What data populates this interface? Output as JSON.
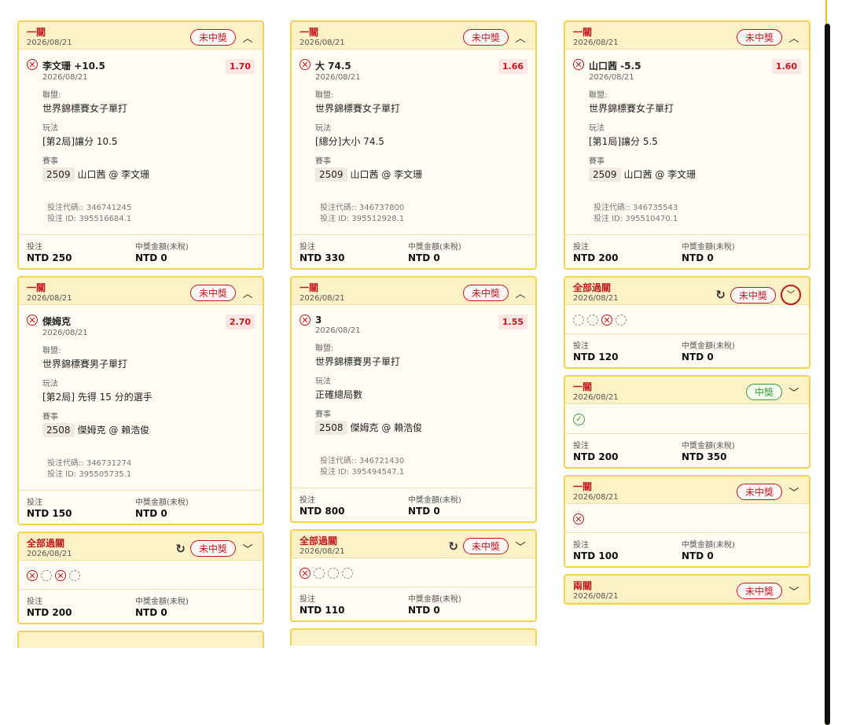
{
  "labels": {
    "league": "聯盟:",
    "market": "玩法",
    "event": "賽事",
    "stake": "投注",
    "payout": "中獎金額(未稅)",
    "code_prefix": "投注代碼:: ",
    "id_prefix": "投注 ID: "
  },
  "colors": {
    "accent": "#c0181d",
    "win": "#3a9d3a",
    "border": "#f5d34a",
    "header_bg": "#fdf2c7"
  },
  "icons": {
    "lost": "x-circle-icon",
    "pending": "dashed-circle-icon",
    "won": "check-circle-icon",
    "refresh": "refresh-icon",
    "collapse": "chevron-up-icon",
    "expand": "chevron-down-icon"
  },
  "columns": [
    [
      {
        "kind": "single",
        "type": "一關",
        "date": "2026/08/21",
        "status": "未中獎",
        "status_kind": "lose",
        "chevron": "up",
        "selection": "李文珊 +10.5",
        "sel_date": "2026/08/21",
        "odds": "1.70",
        "league": "世界錦標賽女子單打",
        "market": "[第2局]讓分 10.5",
        "event_no": "2509",
        "event": "山口茜 @ 李文珊",
        "code": "346741245",
        "bet_id": "395516684.1",
        "stake": "NTD 250",
        "payout": "NTD 0"
      },
      {
        "kind": "single",
        "type": "一關",
        "date": "2026/08/21",
        "status": "未中獎",
        "status_kind": "lose",
        "chevron": "up",
        "selection": "傑姆克",
        "sel_date": "2026/08/21",
        "odds": "2.70",
        "league": "世界錦標賽男子單打",
        "market": "[第2局] 先得 15 分的選手",
        "event_no": "2508",
        "event": "傑姆克 @ 賴浩俊",
        "code": "346731274",
        "bet_id": "395505735.1",
        "stake": "NTD 150",
        "payout": "NTD 0"
      },
      {
        "kind": "parlay",
        "type": "全部過關",
        "date": "2026/08/21",
        "status": "未中獎",
        "status_kind": "lose",
        "chevron": "down",
        "refresh": true,
        "legs": [
          "lost",
          "pending",
          "lost",
          "pending"
        ],
        "stake": "NTD 200",
        "payout": "NTD 0"
      }
    ],
    [
      {
        "kind": "single",
        "type": "一關",
        "date": "2026/08/21",
        "status": "未中獎",
        "status_kind": "lose",
        "chevron": "up",
        "selection": "大 74.5",
        "sel_date": "2026/08/21",
        "odds": "1.66",
        "league": "世界錦標賽女子單打",
        "market": "[總分]大小 74.5",
        "event_no": "2509",
        "event": "山口茜 @ 李文珊",
        "code": "346737800",
        "bet_id": "395512928.1",
        "stake": "NTD 330",
        "payout": "NTD 0"
      },
      {
        "kind": "single",
        "type": "一關",
        "date": "2026/08/21",
        "status": "未中獎",
        "status_kind": "lose",
        "chevron": "up",
        "selection": "3",
        "sel_date": "2026/08/21",
        "odds": "1.55",
        "league": "世界錦標賽男子單打",
        "market": "正確總局數",
        "event_no": "2508",
        "event": "傑姆克 @ 賴浩俊",
        "code": "346721430",
        "bet_id": "395494547.1",
        "stake": "NTD 800",
        "payout": "NTD 0"
      },
      {
        "kind": "parlay",
        "type": "全部過關",
        "date": "2026/08/21",
        "status": "未中獎",
        "status_kind": "lose",
        "chevron": "down",
        "refresh": true,
        "legs": [
          "lost",
          "pending",
          "pending",
          "pending"
        ],
        "stake": "NTD 110",
        "payout": "NTD 0"
      }
    ],
    [
      {
        "kind": "single",
        "type": "一關",
        "date": "2026/08/21",
        "status": "未中獎",
        "status_kind": "lose",
        "chevron": "up",
        "selection": "山口茜 -5.5",
        "sel_date": "2026/08/21",
        "odds": "1.60",
        "league": "世界錦標賽女子單打",
        "market": "[第1局]讓分 5.5",
        "event_no": "2509",
        "event": "山口茜 @ 李文珊",
        "code": "346735543",
        "bet_id": "395510470.1",
        "stake": "NTD 200",
        "payout": "NTD 0"
      },
      {
        "kind": "parlay",
        "type": "全部過關",
        "date": "2026/08/21",
        "status": "未中獎",
        "status_kind": "lose",
        "chevron": "down-circle",
        "refresh": true,
        "legs": [
          "pending",
          "pending",
          "lost",
          "pending"
        ],
        "stake": "NTD 120",
        "payout": "NTD 0"
      },
      {
        "kind": "parlay",
        "type": "一關",
        "date": "2026/08/21",
        "status": "中獎",
        "status_kind": "win",
        "chevron": "down",
        "refresh": false,
        "legs": [
          "won"
        ],
        "stake": "NTD 200",
        "payout": "NTD 350"
      },
      {
        "kind": "parlay",
        "type": "一關",
        "date": "2026/08/21",
        "status": "未中獎",
        "status_kind": "lose",
        "chevron": "down",
        "refresh": false,
        "legs": [
          "lost"
        ],
        "stake": "NTD 100",
        "payout": "NTD 0"
      },
      {
        "kind": "header",
        "type": "兩關",
        "date": "2026/08/21",
        "status": "未中獎",
        "status_kind": "lose",
        "chevron": "down",
        "refresh": false
      }
    ]
  ]
}
